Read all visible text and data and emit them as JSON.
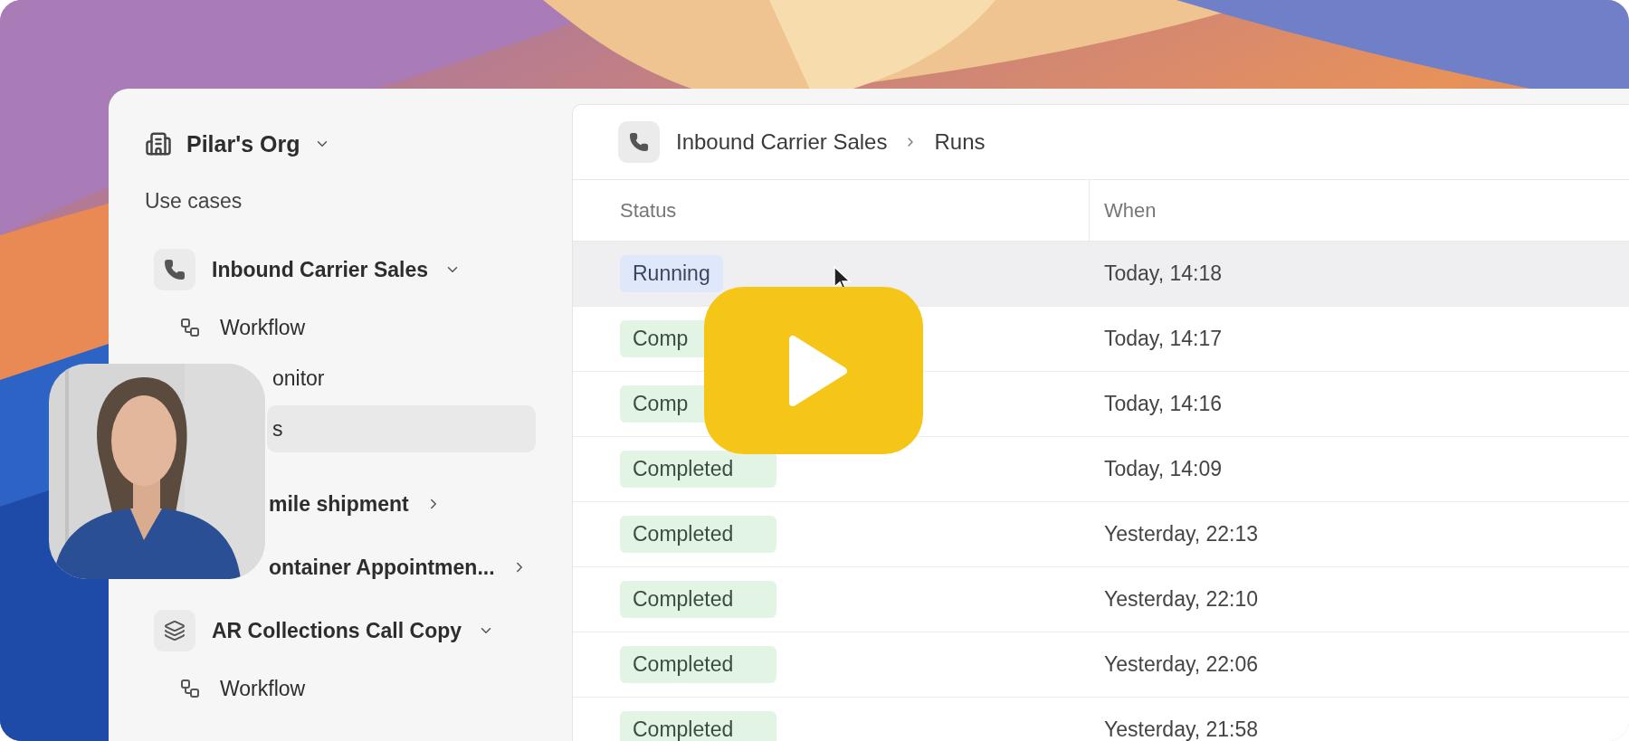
{
  "organization": {
    "name": "Pilar's Org"
  },
  "sidebar": {
    "section_title": "Use cases",
    "items": [
      {
        "label": "Inbound Carrier Sales",
        "expanded": true,
        "selected": false,
        "children": [
          {
            "label": "Workflow",
            "selected": false
          },
          {
            "label": "onitor",
            "selected": false
          },
          {
            "label": "s",
            "selected": true
          }
        ]
      },
      {
        "label": "mile shipment",
        "expanded": false,
        "selected": false
      },
      {
        "label": "ontainer Appointmen...",
        "expanded": false,
        "selected": false
      },
      {
        "label": "AR Collections Call Copy",
        "expanded": true,
        "selected": false,
        "children": [
          {
            "label": "Workflow",
            "selected": false
          }
        ]
      }
    ]
  },
  "breadcrumb": {
    "items": [
      "Inbound Carrier Sales",
      "Runs"
    ]
  },
  "table": {
    "columns": [
      "Status",
      "When"
    ],
    "rows": [
      {
        "status": {
          "label": "Running",
          "kind": "running"
        },
        "when": "Today, 14:18",
        "hovered": true
      },
      {
        "status": {
          "label": "Comp",
          "kind": "completed"
        },
        "when": "Today, 14:17",
        "hovered": false
      },
      {
        "status": {
          "label": "Comp",
          "kind": "completed"
        },
        "when": "Today, 14:16",
        "hovered": false
      },
      {
        "status": {
          "label": "Completed",
          "kind": "completed"
        },
        "when": "Today, 14:09",
        "hovered": false
      },
      {
        "status": {
          "label": "Completed",
          "kind": "completed"
        },
        "when": "Yesterday, 22:13",
        "hovered": false
      },
      {
        "status": {
          "label": "Completed",
          "kind": "completed"
        },
        "when": "Yesterday, 22:10",
        "hovered": false
      },
      {
        "status": {
          "label": "Completed",
          "kind": "completed"
        },
        "when": "Yesterday, 22:06",
        "hovered": false
      },
      {
        "status": {
          "label": "Completed",
          "kind": "completed"
        },
        "when": "Yesterday, 21:58",
        "hovered": false
      }
    ]
  }
}
